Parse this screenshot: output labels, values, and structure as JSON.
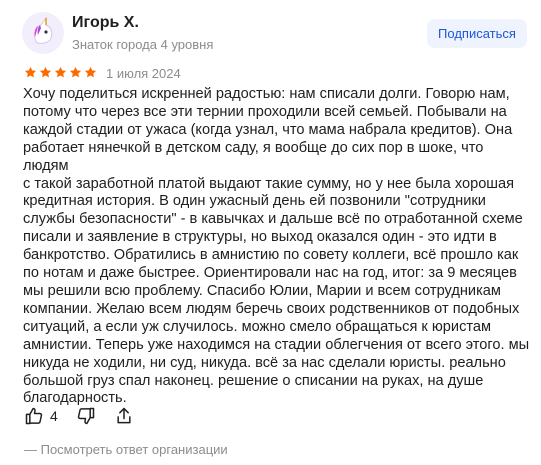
{
  "author": {
    "name": "Игорь Х.",
    "level": "Знаток города 4 уровня",
    "avatar_icon": "unicorn-avatar-icon"
  },
  "subscribe_label": "Подписаться",
  "rating": {
    "stars": 5,
    "max": 5,
    "color": "#fc6b00"
  },
  "date": "1 июля 2024",
  "review_text": "Хочу поделиться искренней радостью: нам списали долги. Говорю нам,\nпотому что через все эти тернии проходили всей семьей. Побывали на\nкаждой стадии от ужаса (когда узнал, что мама набрала кредитов). Она\nработает нянечкой в детском саду, я вообще до сих пор в шоке, что людям\nс такой заработной платой выдают такие сумму, но у нее была хорошая\nкредитная история. В один ужасный день ей позвонили \"сотрудники\nслужбы безопасности\" - в кавычках и дальше всё по отработанной схеме\nписали и заявление в структуры, но выход оказался один - это идти в\nбанкротство. Обратились в амнистию по совету коллеги, всё прошло как\nпо нотам и даже быстрее. Ориентировали нас на год, итог: за 9 месяцев\nмы решили всю проблему. Спасибо Юлии, Марии и всем сотрудникам\nкомпании. Желаю всем людям беречь своих родственников от подобных\nситуаций, а если уж случилось. можно смело обращаться к юристам\nамнистии. Теперь уже находимся на стадии облегчения от всего этого. мы\nникуда не ходили, ни суд, никуда. всё за нас сделали юристы. реально\nбольшой груз спал наконец. решение о списании на руках, на душе\nблагодарность.",
  "actions": {
    "like_count": "4",
    "like_icon": "thumbs-up-icon",
    "dislike_icon": "thumbs-down-icon",
    "share_icon": "share-icon"
  },
  "org_reply_label": "— Посмотреть ответ организации"
}
